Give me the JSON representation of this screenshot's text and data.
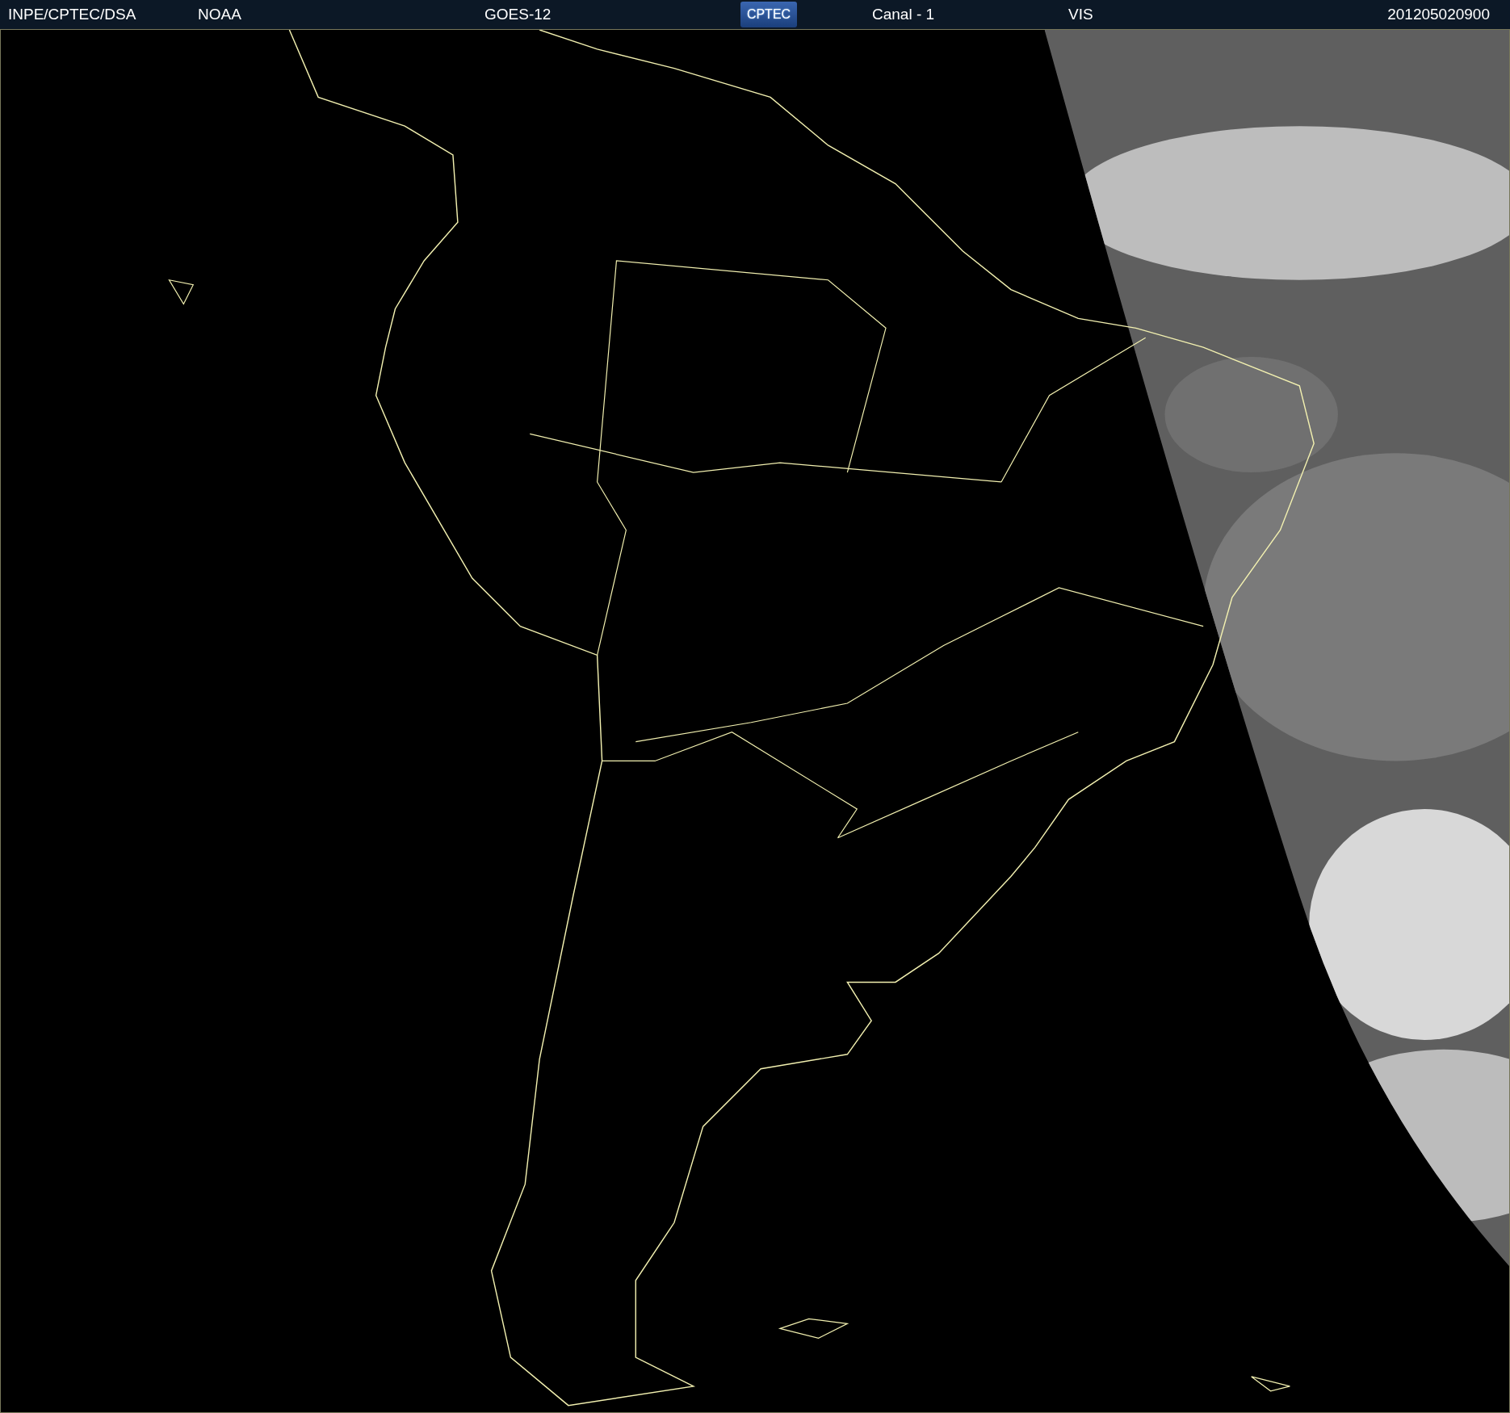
{
  "header": {
    "items": [
      {
        "kind": "label",
        "text": "INPE/CPTEC/DSA"
      },
      {
        "kind": "label",
        "text": "NOAA"
      },
      {
        "kind": "label",
        "text": "GOES-12"
      },
      {
        "kind": "logo",
        "text": "CPTEC"
      },
      {
        "kind": "label",
        "text": "Canal - 1"
      },
      {
        "kind": "label",
        "text": "VIS"
      },
      {
        "kind": "label",
        "text": "201205020900"
      }
    ]
  }
}
